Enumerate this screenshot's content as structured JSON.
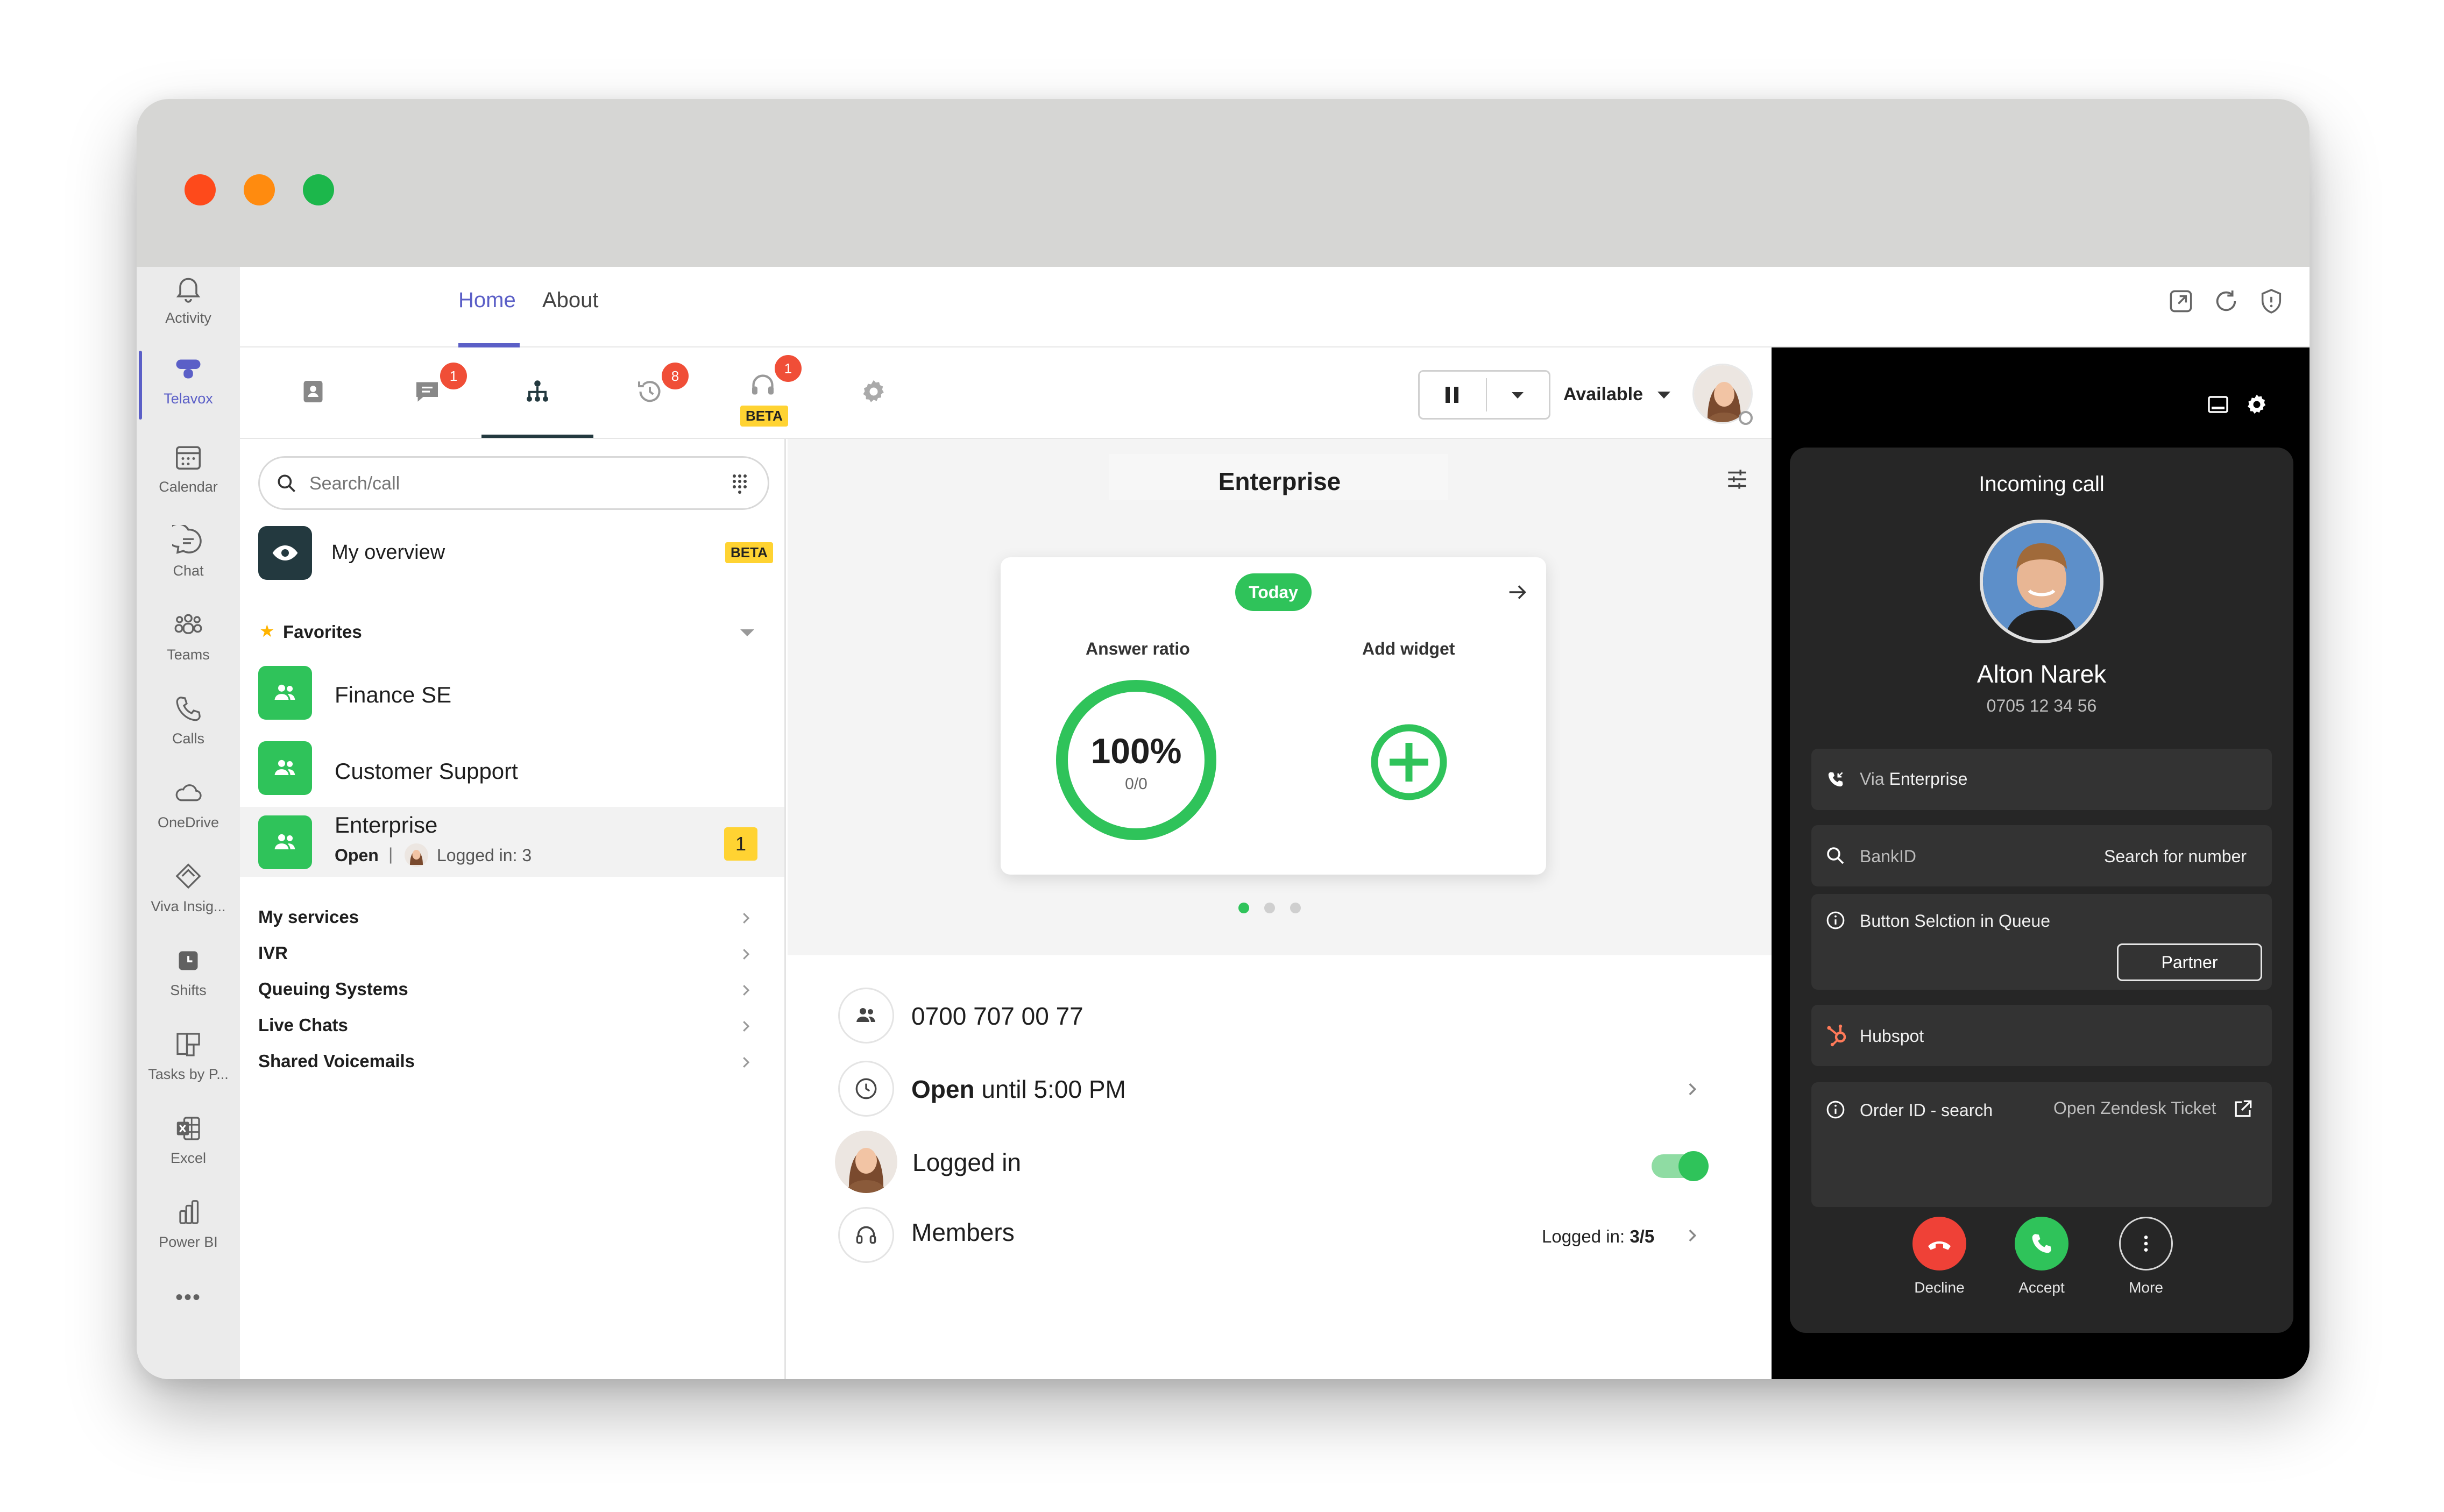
{
  "window": {
    "traffic_lights": [
      "#fe4a1b",
      "#ff8b0f",
      "#1cb74b"
    ]
  },
  "rail": {
    "items": [
      {
        "label": "Activity",
        "icon": "bell-icon"
      },
      {
        "label": "Telavox",
        "icon": "telavox-icon",
        "active": true
      },
      {
        "label": "Calendar",
        "icon": "calendar-icon"
      },
      {
        "label": "Chat",
        "icon": "chat-icon"
      },
      {
        "label": "Teams",
        "icon": "teams-icon"
      },
      {
        "label": "Calls",
        "icon": "phone-icon"
      },
      {
        "label": "OneDrive",
        "icon": "cloud-icon"
      },
      {
        "label": "Viva Insig...",
        "icon": "viva-insights-icon"
      },
      {
        "label": "Shifts",
        "icon": "shifts-icon"
      },
      {
        "label": "Tasks by P...",
        "icon": "tasks-icon"
      },
      {
        "label": "Excel",
        "icon": "excel-icon"
      },
      {
        "label": "Power BI",
        "icon": "power-bi-icon"
      }
    ],
    "more": "•••"
  },
  "nav": {
    "tabs": [
      "Home",
      "About"
    ],
    "active_tab": "Home"
  },
  "toolbar": {
    "badges": {
      "chat": "1",
      "history": "8",
      "queue": "1"
    },
    "beta": "BETA",
    "status": "Available"
  },
  "left": {
    "search_placeholder": "Search/call",
    "overview": {
      "label": "My overview",
      "badge": "BETA"
    },
    "favorites_label": "Favorites",
    "favorites": [
      {
        "name": "Finance SE"
      },
      {
        "name": "Customer Support"
      },
      {
        "name": "Enterprise",
        "status": "Open",
        "separator": "|",
        "logged_in": "Logged in: 3",
        "count": "1"
      }
    ],
    "menu": [
      "My services",
      "IVR",
      "Queuing Systems",
      "Live Chats",
      "Shared Voicemails"
    ]
  },
  "center": {
    "title": "Enterprise",
    "widget": {
      "pill": "Today",
      "answer_ratio_label": "Answer ratio",
      "answer_ratio_value": "100%",
      "answer_ratio_sub": "0/0",
      "add_widget_label": "Add widget",
      "ratio": 1.0
    },
    "pages": {
      "count": 3,
      "active": 1
    },
    "rows": {
      "number": "0700 707 00 77",
      "open_bold": "Open",
      "open_rest": "until 5:00 PM",
      "logged_in": "Logged in",
      "logged_in_toggle": true,
      "members": "Members",
      "members_prefix": "Logged in:",
      "members_count": "3/5"
    }
  },
  "call": {
    "title": "Incoming call",
    "name": "Alton Narek",
    "number": "0705 12 34 56",
    "via_prefix": "Via",
    "via_name": "Enterprise",
    "bankid_label": "BankID",
    "bankid_action": "Search for number",
    "queue_label": "Button Selction in Queue",
    "partner_button": "Partner",
    "hubspot_label": "Hubspot",
    "order_label": "Order ID - search",
    "zendesk_label": "Open Zendesk Ticket",
    "decline": "Decline",
    "accept": "Accept",
    "more": "More",
    "colors": {
      "decline": "#ef4137",
      "accept": "#2fc35a",
      "hubspot": "#ff7a59"
    }
  }
}
